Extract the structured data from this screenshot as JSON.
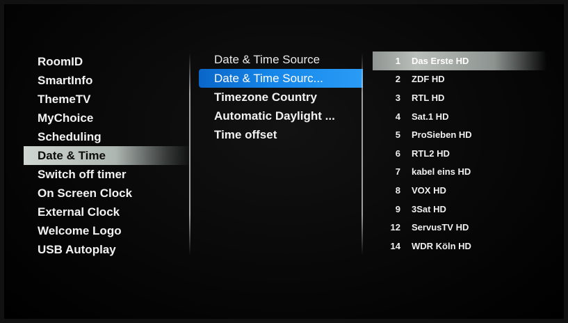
{
  "left_menu": {
    "items": [
      {
        "label": "RoomID"
      },
      {
        "label": "SmartInfo"
      },
      {
        "label": "ThemeTV"
      },
      {
        "label": "MyChoice"
      },
      {
        "label": "Scheduling"
      },
      {
        "label": "Date & Time",
        "selected": true
      },
      {
        "label": "Switch off timer"
      },
      {
        "label": "On Screen Clock"
      },
      {
        "label": "External Clock"
      },
      {
        "label": "Welcome Logo"
      },
      {
        "label": "USB Autoplay"
      }
    ]
  },
  "middle_menu": {
    "header": "Date & Time Source",
    "items": [
      {
        "label": "Date & Time Sourc...",
        "highlighted": true
      },
      {
        "label": "Timezone Country"
      },
      {
        "label": "Automatic Daylight ..."
      },
      {
        "label": "Time offset"
      }
    ]
  },
  "channel_list": {
    "channels": [
      {
        "number": "1",
        "name": "Das Erste HD",
        "selected": true
      },
      {
        "number": "2",
        "name": "ZDF HD"
      },
      {
        "number": "3",
        "name": "RTL HD"
      },
      {
        "number": "4",
        "name": "Sat.1 HD"
      },
      {
        "number": "5",
        "name": "ProSieben HD"
      },
      {
        "number": "6",
        "name": "RTL2 HD"
      },
      {
        "number": "7",
        "name": "kabel eins HD"
      },
      {
        "number": "8",
        "name": "VOX HD"
      },
      {
        "number": "9",
        "name": "3Sat HD"
      },
      {
        "number": "12",
        "name": "ServusTV HD"
      },
      {
        "number": "14",
        "name": "WDR Köln HD"
      }
    ]
  },
  "colors": {
    "highlight_blue": "#1687ea",
    "selection_grey": "#b9beba",
    "background": "#050505"
  }
}
